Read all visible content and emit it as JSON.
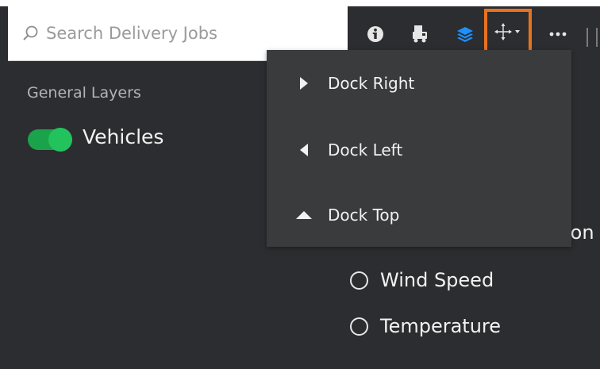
{
  "search": {
    "placeholder": "Search Delivery Jobs",
    "value": ""
  },
  "toolbar": {
    "icons": [
      "info-icon",
      "truck-icon",
      "layers-icon",
      "move-dock-icon",
      "more-icon"
    ],
    "active_color": "#1e90ff",
    "highlight_color": "#e8731f"
  },
  "sidebar": {
    "section_title": "General Layers",
    "vehicles": {
      "label": "Vehicles",
      "enabled": true
    }
  },
  "dock_menu": {
    "items": [
      {
        "icon": "triangle-right-icon",
        "label": "Dock Right"
      },
      {
        "icon": "triangle-left-icon",
        "label": "Dock Left"
      },
      {
        "icon": "triangle-up-icon",
        "label": "Dock Top"
      }
    ]
  },
  "weather_layers": {
    "clipped_text": "ion",
    "options": [
      {
        "label": "Wind Speed",
        "selected": false
      },
      {
        "label": "Temperature",
        "selected": false
      }
    ]
  },
  "colors": {
    "panel_bg": "#2c2d30",
    "menu_bg": "#3a3b3d",
    "toggle_on": "#22c35d"
  }
}
